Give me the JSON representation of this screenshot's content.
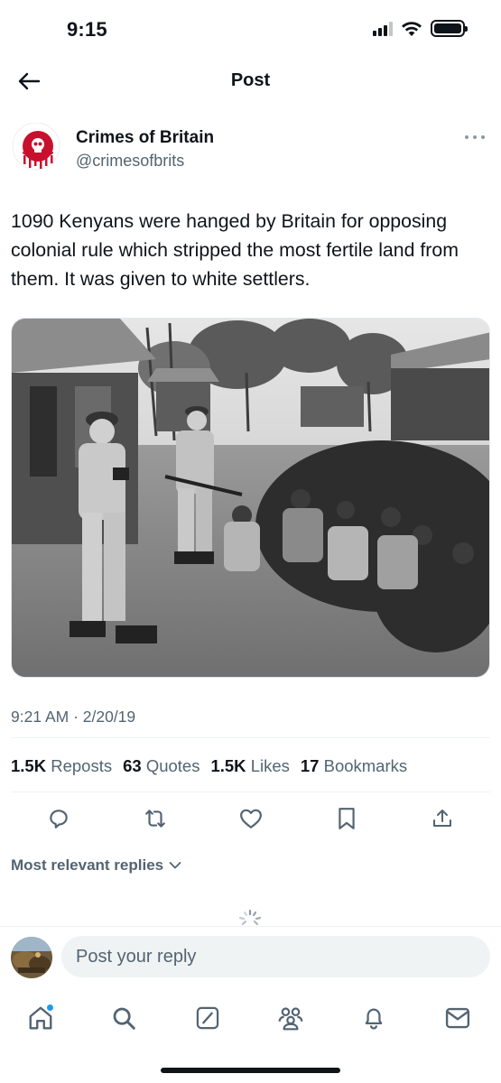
{
  "status_bar": {
    "time": "9:15"
  },
  "header": {
    "title": "Post"
  },
  "author": {
    "name": "Crimes of Britain",
    "handle": "@crimesofbrits"
  },
  "post": {
    "text": "1090 Kenyans were hanged by Britain for opposing colonial rule which stripped the most fertile land from them. It was given to white settlers.",
    "timestamp": "9:21 AM · 2/20/19"
  },
  "stats": [
    {
      "count": "1.5K",
      "label": "Reposts"
    },
    {
      "count": "63",
      "label": "Quotes"
    },
    {
      "count": "1.5K",
      "label": "Likes"
    },
    {
      "count": "17",
      "label": "Bookmarks"
    }
  ],
  "actions": [
    "reply-icon",
    "repost-icon",
    "like-icon",
    "bookmark-icon",
    "share-icon"
  ],
  "replies": {
    "sort_label": "Most relevant replies"
  },
  "reply_bar": {
    "placeholder": "Post your reply"
  },
  "tab_bar": [
    "home-icon",
    "search-icon",
    "grok-icon",
    "communities-icon",
    "notifications-icon",
    "messages-icon"
  ],
  "colors": {
    "accent": "#1d9bf0",
    "text": "#0f1419",
    "secondary": "#536471",
    "logo_red": "#c8102e"
  }
}
